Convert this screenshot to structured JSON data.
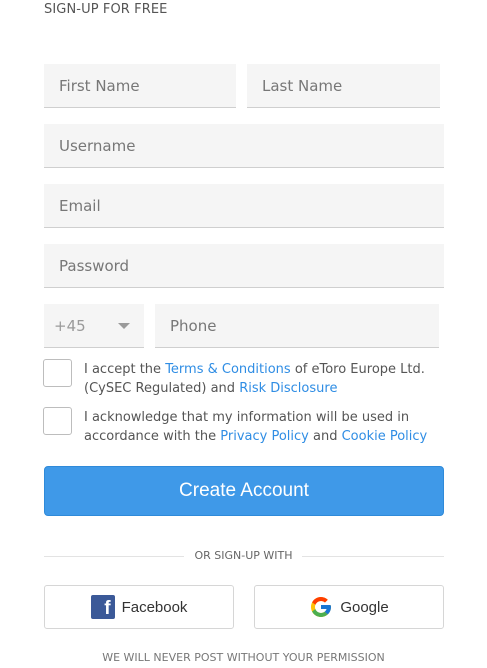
{
  "header": {
    "title": "SIGN-UP FOR FREE"
  },
  "form": {
    "first_name_placeholder": "First Name",
    "last_name_placeholder": "Last Name",
    "username_placeholder": "Username",
    "email_placeholder": "Email",
    "password_placeholder": "Password",
    "phone_code": "+45",
    "phone_placeholder": "Phone"
  },
  "consent": {
    "terms_prefix": "I accept the ",
    "terms_link": "Terms & Conditions",
    "terms_middle": " of eToro Europe Ltd. (CySEC Regulated) and ",
    "risk_link": "Risk Disclosure",
    "privacy_prefix": "I acknowledge that my information will be used in accordance with the ",
    "privacy_link": "Privacy Policy",
    "privacy_and": " and ",
    "cookie_link": "Cookie Policy"
  },
  "actions": {
    "create_account": "Create Account"
  },
  "social": {
    "divider_text": "OR SIGN-UP WITH",
    "facebook_label": "Facebook",
    "google_label": "Google",
    "footer_note": "WE WILL NEVER POST WITHOUT YOUR PERMISSION"
  },
  "colors": {
    "accent": "#3f99e8",
    "link": "#2f8de4",
    "facebook": "#3b5998"
  },
  "icons": {
    "facebook": "facebook-icon",
    "google": "google-icon",
    "dropdown": "chevron-down-icon"
  }
}
